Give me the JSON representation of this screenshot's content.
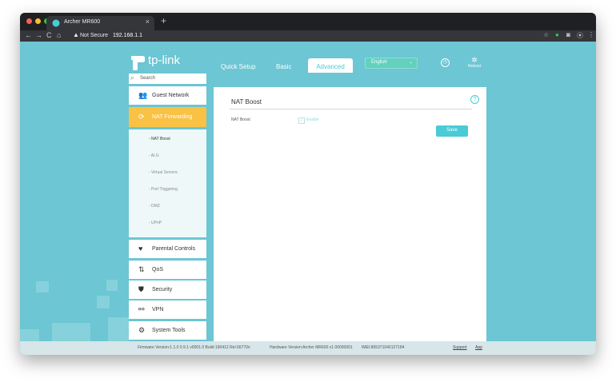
{
  "browser": {
    "tab_title": "Archer MR600",
    "tab_close": "×",
    "new_tab": "+",
    "nav": {
      "back": "←",
      "forward": "→",
      "reload": "C",
      "home": "⌂"
    },
    "security_label": "Not Secure",
    "url": "192.168.1.1",
    "traffic_colors": {
      "close": "#ff5f57",
      "minimize": "#febc2e",
      "maximize": "#28c840"
    }
  },
  "header": {
    "logo_text": "tp-link",
    "tabs": [
      {
        "label": "Quick Setup"
      },
      {
        "label": "Basic"
      },
      {
        "label": "Advanced"
      }
    ],
    "active_tab": "Advanced",
    "language": "English",
    "reboot_label": "Reboot"
  },
  "sidebar": {
    "search_placeholder": "Search",
    "items": [
      {
        "label": "Guest Network",
        "icon": "guest-network-icon",
        "glyph": "👥"
      },
      {
        "label": "NAT Forwarding",
        "icon": "nat-forwarding-icon",
        "glyph": "⟳"
      },
      {
        "label": "Parental Controls",
        "icon": "parental-controls-icon",
        "glyph": "♥"
      },
      {
        "label": "QoS",
        "icon": "qos-icon",
        "glyph": "⇅"
      },
      {
        "label": "Security",
        "icon": "shield-icon",
        "glyph": "⛊"
      },
      {
        "label": "VPN",
        "icon": "vpn-icon",
        "glyph": "⚯"
      },
      {
        "label": "System Tools",
        "icon": "gear-icon",
        "glyph": "⚙"
      }
    ],
    "subitems": [
      {
        "label": "- NAT Boost"
      },
      {
        "label": "- ALG"
      },
      {
        "label": "- Virtual Servers"
      },
      {
        "label": "- Port Triggering"
      },
      {
        "label": "- DMZ"
      },
      {
        "label": "- UPnP"
      }
    ]
  },
  "main": {
    "title": "NAT Boost",
    "field_label": "NAT Boost",
    "checkbox_label": "Enable",
    "checkbox_checked": true,
    "save_label": "Save"
  },
  "footer": {
    "firmware": "Firmware Version:1.1.0 0.9.1 v0001.0 Build 190412 Rel.66770n",
    "hardware": "Hardware Version:Archer MR600 v1 00000001",
    "imei": "IMEI:865371040127184",
    "support": "Support",
    "app": "App"
  },
  "colors": {
    "accent": "#4acbd6",
    "background": "#6cc6d3",
    "active_menu": "#f9c244"
  }
}
